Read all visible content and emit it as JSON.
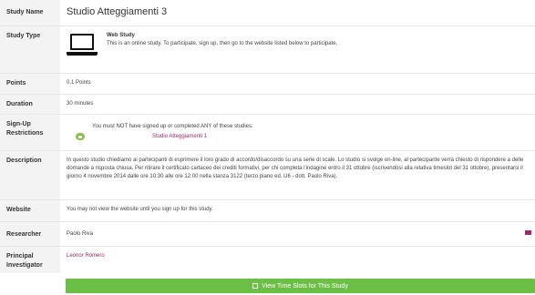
{
  "rows": {
    "study_name": {
      "label": "Study Name",
      "value": "Studio Atteggiamenti 3"
    },
    "study_type": {
      "label": "Study Type",
      "title": "Web Study",
      "description": "This is an online study. To participate, sign up, then go to the website listed below to participate.",
      "icon": "laptop-icon"
    },
    "points": {
      "label": "Points",
      "value": "0.1 Points"
    },
    "duration": {
      "label": "Duration",
      "value": "30 minutes"
    },
    "restrictions": {
      "label": "Sign-Up Restrictions",
      "text": "You must NOT have signed up or completed ANY of these studies:",
      "study_link": "Studio Atteggiamenti 1"
    },
    "description": {
      "label": "Description",
      "value": "In questo studio chiediamo ai partecipanti di esprimere il loro grado di accordo/disaccordo su una serie di scale. Lo studio si svolge on-line, al partecipante verrà chiesto di rispondere a delle domande a risposta chiusa. Per ritirare il certificato cartaceo dei crediti formativi, per chi completa l'indagine entro il 31 ottobre (iscrivendosi alla relativa timeslot del 31 ottobre), presentarsi il giorno 4 novembre 2014 dalle ore 10:30 alle ore 12:00 nella stanza 3122 (terzo piano ed. U6 - dott. Paolo Riva)."
    },
    "website": {
      "label": "Website",
      "value": "You may not view the website until you sign up for this study."
    },
    "researcher": {
      "label": "Researcher",
      "value": "Paolo Riva"
    },
    "pi": {
      "label": "Principal Investigator",
      "value": "Leonor Romero"
    }
  },
  "button": {
    "label": "View Time Slots for This Study",
    "icon": "external-link-icon"
  },
  "colors": {
    "accent": "#9b2a66",
    "button": "#6cbf46",
    "label_bg": "#f3f3f3",
    "badge": "#8cc152"
  }
}
